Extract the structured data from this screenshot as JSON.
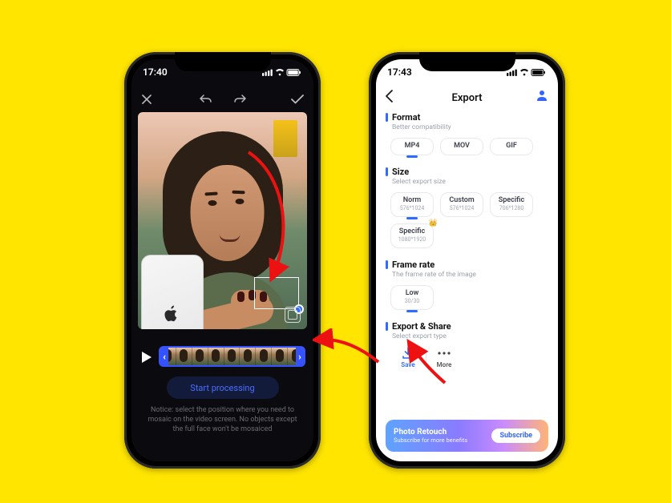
{
  "editor": {
    "status_time": "17:40",
    "start_processing": "Start processing",
    "notice": "Notice: select the position where you need to mosaic on the video screen. No objects except the full face won't be mosaiced"
  },
  "export": {
    "status_time": "17:43",
    "title": "Export",
    "sections": {
      "format": {
        "title": "Format",
        "sub": "Better compatibility",
        "options": [
          {
            "label": "MP4",
            "selected": true
          },
          {
            "label": "MOV",
            "selected": false
          },
          {
            "label": "GIF",
            "selected": false
          }
        ]
      },
      "size": {
        "title": "Size",
        "sub": "Select export size",
        "options": [
          {
            "label": "Norm",
            "sub": "576*1024",
            "selected": true
          },
          {
            "label": "Custom",
            "sub": "576*1024",
            "selected": false
          },
          {
            "label": "Specific",
            "sub": "706*1280",
            "selected": false
          },
          {
            "label": "Specific",
            "sub": "1080*1920",
            "selected": false,
            "crown": true
          }
        ]
      },
      "framerate": {
        "title": "Frame rate",
        "sub": "The frame rate of the image",
        "options": [
          {
            "label": "Low",
            "sub": "30/30",
            "selected": true
          }
        ]
      },
      "exportshare": {
        "title": "Export & Share",
        "sub": "Select export type",
        "save": "Save",
        "more": "More"
      }
    },
    "promo": {
      "title": "Photo Retouch",
      "sub": "Subscribe for more benefits",
      "cta": "Subscribe"
    }
  }
}
